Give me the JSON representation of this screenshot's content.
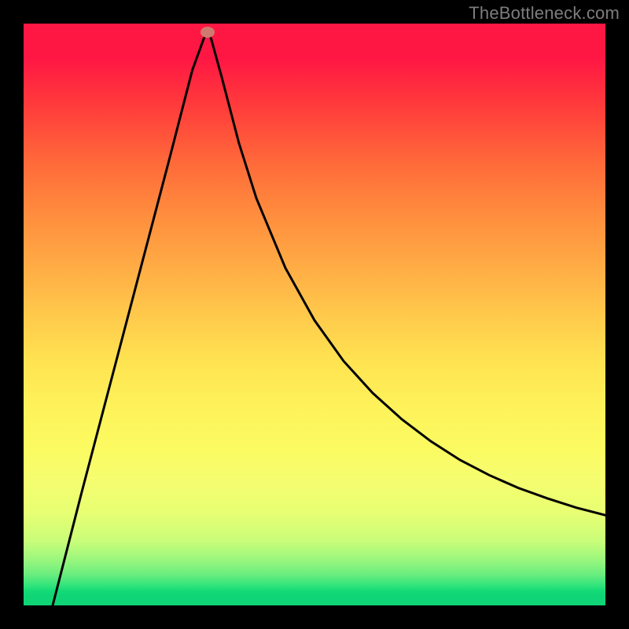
{
  "attribution": "TheBottleneck.com",
  "chart_data": {
    "type": "line",
    "title": "",
    "xlabel": "",
    "ylabel": "",
    "xlim": [
      0,
      1
    ],
    "ylim": [
      0,
      1
    ],
    "grid": false,
    "legend": false,
    "series": [
      {
        "name": "curve",
        "x": [
          0.05,
          0.1,
          0.15,
          0.2,
          0.25,
          0.29,
          0.31,
          0.316,
          0.322,
          0.34,
          0.37,
          0.4,
          0.45,
          0.5,
          0.55,
          0.6,
          0.65,
          0.7,
          0.75,
          0.8,
          0.85,
          0.9,
          0.95,
          1.0
        ],
        "values": [
          0.0,
          0.195,
          0.385,
          0.575,
          0.765,
          0.92,
          0.975,
          0.985,
          0.975,
          0.91,
          0.795,
          0.7,
          0.58,
          0.49,
          0.42,
          0.365,
          0.32,
          0.282,
          0.25,
          0.224,
          0.202,
          0.184,
          0.168,
          0.155
        ]
      }
    ],
    "marker": {
      "x": 0.316,
      "y": 0.985,
      "color": "#cf7a71"
    },
    "background_gradient": {
      "top": "#ff1744",
      "mid": "#ffe351",
      "bottom": "#0fd576"
    }
  }
}
